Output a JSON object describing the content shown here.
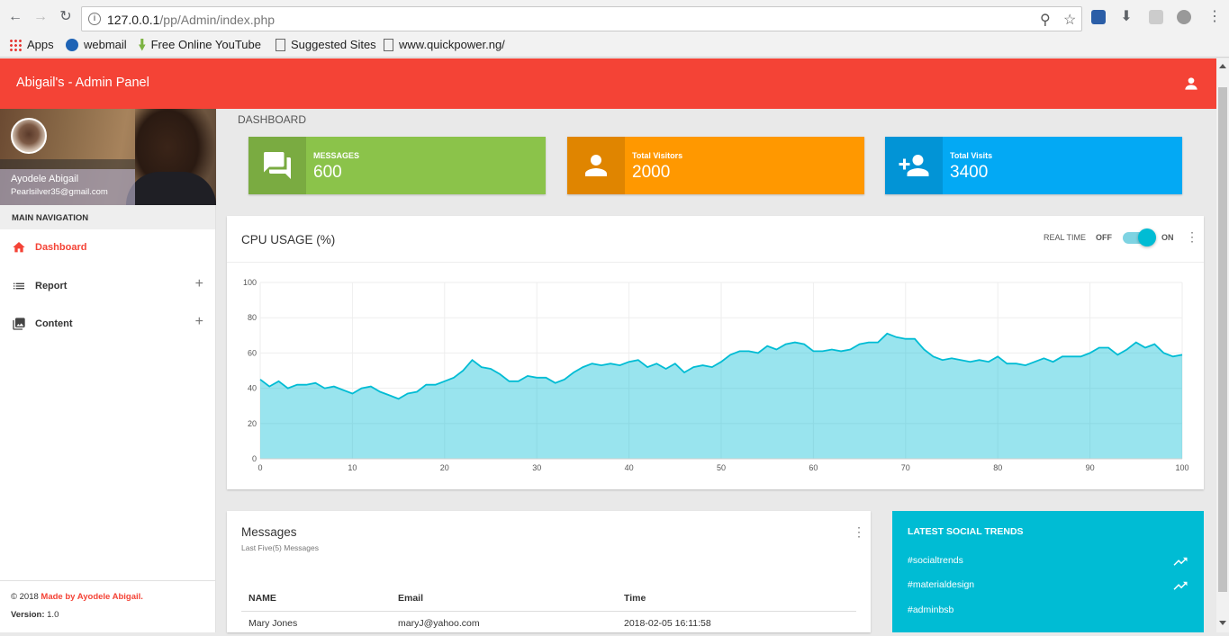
{
  "browser": {
    "url_host": "127.0.0.1",
    "url_path": "/pp/Admin/index.php",
    "bookmarks": [
      "Apps",
      "webmail",
      "Free Online YouTube",
      "Suggested Sites",
      "www.quickpower.ng/"
    ]
  },
  "header": {
    "title": "Abigail's - Admin Panel"
  },
  "sidebar": {
    "user_name": "Ayodele Abigail",
    "user_email": "Pearlsilver35@gmail.com",
    "nav_header": "MAIN NAVIGATION",
    "items": [
      {
        "label": "Dashboard",
        "icon": "home-icon",
        "active": true
      },
      {
        "label": "Report",
        "icon": "list-icon",
        "expandable": true
      },
      {
        "label": "Content",
        "icon": "image-icon",
        "expandable": true
      }
    ],
    "footer_copyright": "© 2018",
    "footer_made": "Made by Ayodele Abigail.",
    "footer_version_label": "Version:",
    "footer_version": "1.0"
  },
  "page": {
    "title": "DASHBOARD"
  },
  "info_boxes": [
    {
      "label": "MESSAGES",
      "value": "600",
      "color": "#8bc34a",
      "icon": "forum-icon"
    },
    {
      "label": "Total Visitors",
      "value": "2000",
      "color": "#ff9800",
      "icon": "person-icon"
    },
    {
      "label": "Total Visits",
      "value": "3400",
      "color": "#03a9f4",
      "icon": "person-add-icon"
    }
  ],
  "cpu": {
    "title": "CPU USAGE (%)",
    "realtime_label": "REAL TIME",
    "off_label": "OFF",
    "on_label": "ON",
    "realtime_on": true
  },
  "chart_data": {
    "type": "area",
    "title": "CPU USAGE (%)",
    "xlabel": "",
    "ylabel": "",
    "xlim": [
      0,
      100
    ],
    "ylim": [
      0,
      100
    ],
    "x_ticks": [
      0,
      10,
      20,
      30,
      40,
      50,
      60,
      70,
      80,
      90,
      100
    ],
    "y_ticks": [
      0,
      20,
      40,
      60,
      80,
      100
    ],
    "grid": true,
    "color": "#00bcd4",
    "values": [
      45,
      41,
      44,
      40,
      42,
      42,
      43,
      40,
      41,
      39,
      37,
      40,
      41,
      38,
      36,
      34,
      37,
      38,
      42,
      42,
      44,
      46,
      50,
      56,
      52,
      51,
      48,
      44,
      44,
      47,
      46,
      46,
      43,
      45,
      49,
      52,
      54,
      53,
      54,
      53,
      55,
      56,
      52,
      54,
      51,
      54,
      49,
      52,
      53,
      52,
      55,
      59,
      61,
      61,
      60,
      64,
      62,
      65,
      66,
      65,
      61,
      61,
      62,
      61,
      62,
      65,
      66,
      66,
      71,
      69,
      68,
      68,
      62,
      58,
      56,
      57,
      56,
      55,
      56,
      55,
      58,
      54,
      54,
      53,
      55,
      57,
      55,
      58,
      58,
      58,
      60,
      63,
      63,
      59,
      62,
      66,
      63,
      65,
      60,
      58,
      59
    ]
  },
  "messages": {
    "title": "Messages",
    "subtitle": "Last Five(5) Messages",
    "columns": [
      "NAME",
      "Email",
      "Time"
    ],
    "rows": [
      [
        "Mary Jones",
        "maryJ@yahoo.com",
        "2018-02-05 16:11:58"
      ]
    ]
  },
  "social": {
    "title": "LATEST SOCIAL TRENDS",
    "trends": [
      "#socialtrends",
      "#materialdesign",
      "#adminbsb"
    ]
  }
}
